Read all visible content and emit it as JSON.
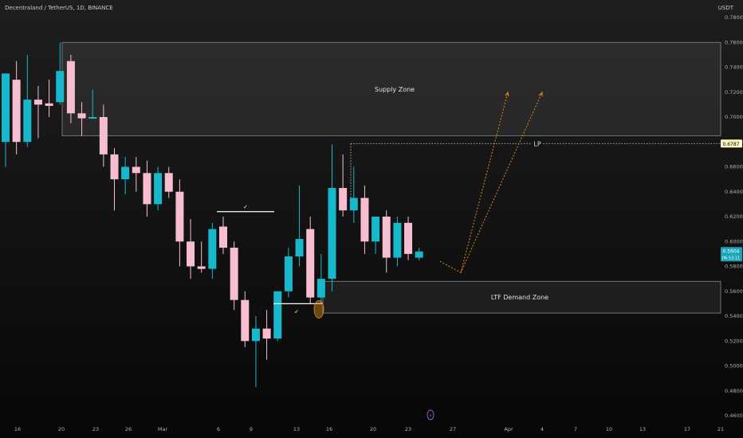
{
  "header": {
    "symbol_title": "Decentraland / TetherUS, 1D, BINANCE",
    "currency": "USDT"
  },
  "colors": {
    "up": "#18b8cc",
    "down": "#f7bed0",
    "zone_fill": "#ffffff",
    "marker_orange": "#e08a1e",
    "lp_label_bg": "#fff9c4",
    "price_label_bg": "#1aa6b8"
  },
  "zones": {
    "supply": {
      "label": "Supply Zone",
      "top": 0.76,
      "bottom": 0.685
    },
    "demand": {
      "label": "LTF Demand Zone",
      "top": 0.568,
      "bottom": 0.5425
    }
  },
  "lp": {
    "label": "LP",
    "price": 0.6787,
    "price_text": "0.6787"
  },
  "current_price": {
    "text": "0.5904",
    "sub_text": "06:53:11"
  },
  "annotations": {
    "check_mark": "✓",
    "event_icon": "⚡"
  },
  "chart_data": {
    "type": "candlestick",
    "title": "Decentraland / TetherUS, 1D, BINANCE",
    "y_axis": {
      "unit": "USDT",
      "ylim": [
        0.46,
        0.78
      ],
      "ticks": [
        "0.7800",
        "0.7600",
        "0.7400",
        "0.7200",
        "0.7000",
        "0.6800",
        "0.6600",
        "0.6400",
        "0.6200",
        "0.6000",
        "0.5800",
        "0.5600",
        "0.5400",
        "0.5200",
        "0.5000",
        "0.4800",
        "0.4600"
      ]
    },
    "x_axis": {
      "tick_labels": [
        "16",
        "20",
        "23",
        "26",
        "Mar",
        "6",
        "9",
        "13",
        "16",
        "20",
        "23",
        "27",
        "Apr",
        "4",
        "7",
        "10",
        "13",
        "17",
        "21"
      ]
    },
    "candles": [
      {
        "o": 0.68,
        "h": 0.72,
        "l": 0.66,
        "c": 0.735
      },
      {
        "o": 0.73,
        "h": 0.745,
        "l": 0.67,
        "c": 0.68
      },
      {
        "o": 0.68,
        "h": 0.75,
        "l": 0.676,
        "c": 0.714
      },
      {
        "o": 0.714,
        "h": 0.725,
        "l": 0.683,
        "c": 0.71
      },
      {
        "o": 0.711,
        "h": 0.73,
        "l": 0.7,
        "c": 0.709
      },
      {
        "o": 0.712,
        "h": 0.76,
        "l": 0.71,
        "c": 0.737
      },
      {
        "o": 0.745,
        "h": 0.75,
        "l": 0.695,
        "c": 0.703
      },
      {
        "o": 0.703,
        "h": 0.712,
        "l": 0.685,
        "c": 0.699
      },
      {
        "o": 0.7,
        "h": 0.722,
        "l": 0.7,
        "c": 0.7
      },
      {
        "o": 0.7,
        "h": 0.71,
        "l": 0.66,
        "c": 0.67
      },
      {
        "o": 0.67,
        "h": 0.675,
        "l": 0.625,
        "c": 0.65
      },
      {
        "o": 0.65,
        "h": 0.668,
        "l": 0.638,
        "c": 0.66
      },
      {
        "o": 0.66,
        "h": 0.668,
        "l": 0.64,
        "c": 0.655
      },
      {
        "o": 0.655,
        "h": 0.665,
        "l": 0.62,
        "c": 0.63
      },
      {
        "o": 0.63,
        "h": 0.66,
        "l": 0.625,
        "c": 0.655
      },
      {
        "o": 0.655,
        "h": 0.66,
        "l": 0.635,
        "c": 0.64
      },
      {
        "o": 0.64,
        "h": 0.65,
        "l": 0.58,
        "c": 0.6
      },
      {
        "o": 0.6,
        "h": 0.618,
        "l": 0.57,
        "c": 0.58
      },
      {
        "o": 0.58,
        "h": 0.6,
        "l": 0.575,
        "c": 0.578
      },
      {
        "o": 0.578,
        "h": 0.615,
        "l": 0.57,
        "c": 0.61
      },
      {
        "o": 0.612,
        "h": 0.62,
        "l": 0.59,
        "c": 0.595
      },
      {
        "o": 0.595,
        "h": 0.6,
        "l": 0.545,
        "c": 0.553
      },
      {
        "o": 0.553,
        "h": 0.56,
        "l": 0.515,
        "c": 0.52
      },
      {
        "o": 0.52,
        "h": 0.54,
        "l": 0.483,
        "c": 0.53
      },
      {
        "o": 0.53,
        "h": 0.545,
        "l": 0.505,
        "c": 0.522
      },
      {
        "o": 0.522,
        "h": 0.56,
        "l": 0.52,
        "c": 0.56
      },
      {
        "o": 0.56,
        "h": 0.595,
        "l": 0.555,
        "c": 0.588
      },
      {
        "o": 0.588,
        "h": 0.645,
        "l": 0.58,
        "c": 0.602
      },
      {
        "o": 0.61,
        "h": 0.62,
        "l": 0.55,
        "c": 0.555
      },
      {
        "o": 0.555,
        "h": 0.59,
        "l": 0.55,
        "c": 0.57
      },
      {
        "o": 0.57,
        "h": 0.678,
        "l": 0.56,
        "c": 0.643
      },
      {
        "o": 0.643,
        "h": 0.67,
        "l": 0.62,
        "c": 0.625
      },
      {
        "o": 0.625,
        "h": 0.66,
        "l": 0.615,
        "c": 0.635
      },
      {
        "o": 0.635,
        "h": 0.645,
        "l": 0.59,
        "c": 0.6
      },
      {
        "o": 0.6,
        "h": 0.62,
        "l": 0.59,
        "c": 0.62
      },
      {
        "o": 0.62,
        "h": 0.625,
        "l": 0.575,
        "c": 0.587
      },
      {
        "o": 0.587,
        "h": 0.62,
        "l": 0.58,
        "c": 0.615
      },
      {
        "o": 0.615,
        "h": 0.62,
        "l": 0.585,
        "c": 0.59
      },
      {
        "o": 0.587,
        "h": 0.595,
        "l": 0.585,
        "c": 0.592
      }
    ],
    "projection_paths": [
      [
        [
          0.584,
          "rel0"
        ],
        [
          0.574,
          "rel1"
        ],
        [
          0.7199,
          "rel2"
        ]
      ],
      [
        [
          0.574,
          "rel1"
        ],
        [
          0.7199,
          "rel3"
        ]
      ]
    ],
    "structure_lines": [
      {
        "price": 0.624,
        "label": "✓"
      },
      {
        "price": 0.55,
        "label": "✓"
      }
    ]
  }
}
